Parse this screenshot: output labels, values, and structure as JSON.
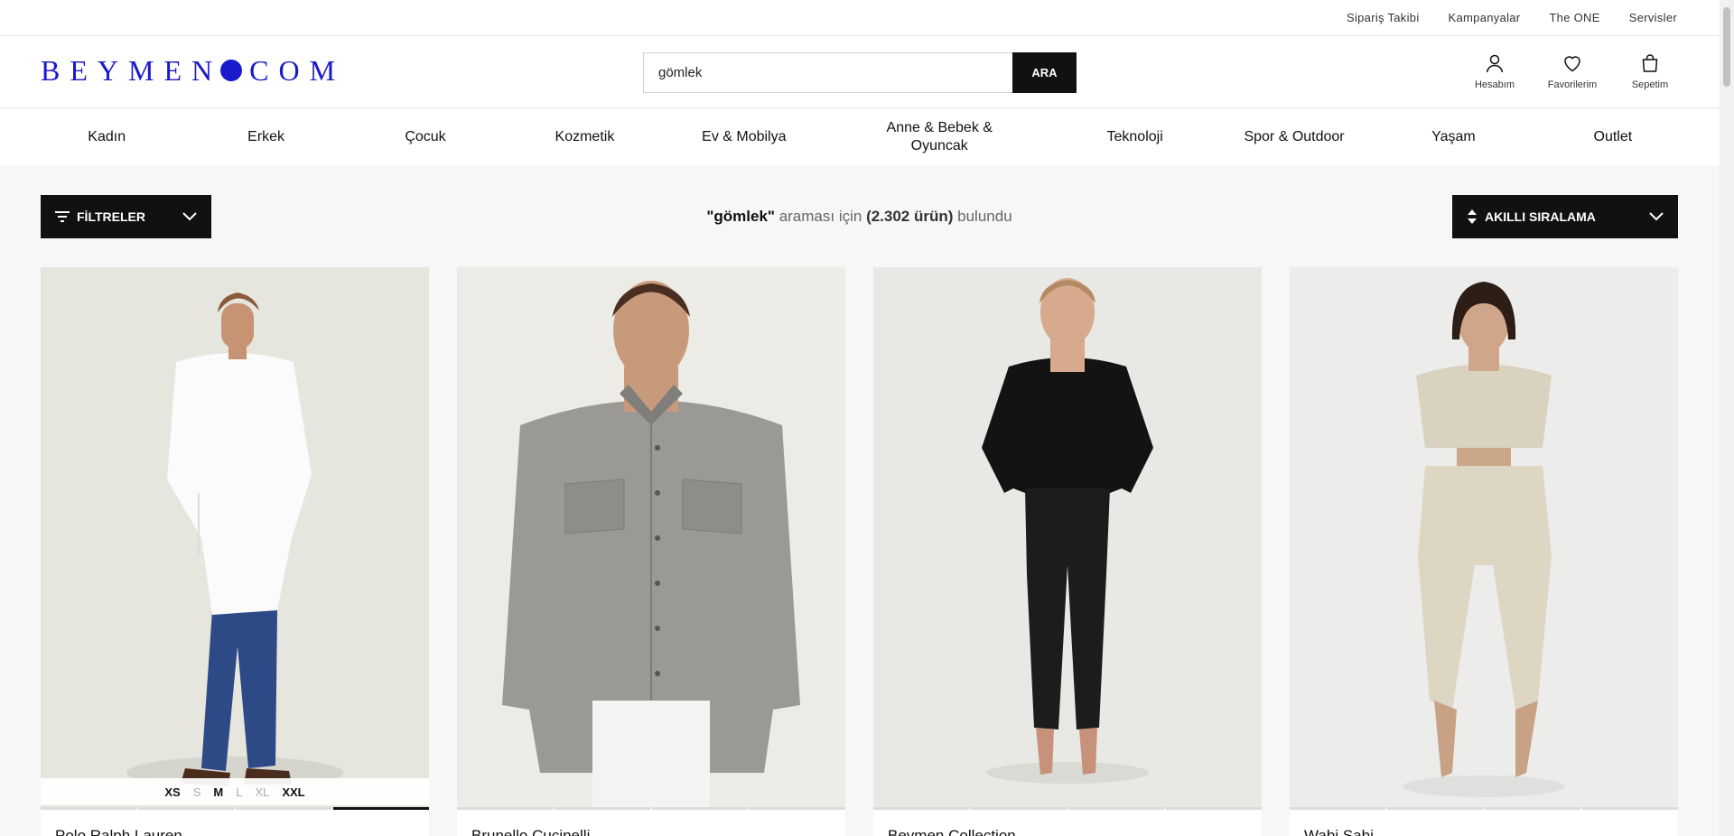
{
  "utility_links": [
    "Sipariş Takibi",
    "Kampanyalar",
    "The ONE",
    "Servisler"
  ],
  "logo": {
    "left": "BEYMEN",
    "right": "COM",
    "color": "#1a1acd"
  },
  "search": {
    "value": "gömlek",
    "button": "ARA"
  },
  "header_icons": [
    {
      "label": "Hesabım",
      "icon": "user-icon"
    },
    {
      "label": "Favorilerim",
      "icon": "heart-icon"
    },
    {
      "label": "Sepetim",
      "icon": "bag-icon"
    }
  ],
  "categories": [
    "Kadın",
    "Erkek",
    "Çocuk",
    "Kozmetik",
    "Ev & Mobilya",
    "Anne & Bebek & Oyuncak",
    "Teknoloji",
    "Spor & Outdoor",
    "Yaşam",
    "Outlet"
  ],
  "toolbar": {
    "filter_label": "FİLTRELER",
    "sort_label": "AKILLI SIRALAMA",
    "query": "\"gömlek\"",
    "mid_text": " araması için ",
    "count": "(2.302 ürün)",
    "end_text": " bulundu"
  },
  "products": [
    {
      "brand": "Polo Ralph Lauren",
      "sizes": [
        {
          "s": "XS",
          "a": true
        },
        {
          "s": "S",
          "a": false
        },
        {
          "s": "M",
          "a": true
        },
        {
          "s": "L",
          "a": false
        },
        {
          "s": "XL",
          "a": false
        },
        {
          "s": "XXL",
          "a": true
        }
      ]
    },
    {
      "brand": "Brunello Cucinelli"
    },
    {
      "brand": "Beymen Collection"
    },
    {
      "brand": "Wabi Sabi"
    }
  ],
  "colors": {
    "accent": "#1a1acd",
    "dark": "#111111"
  }
}
